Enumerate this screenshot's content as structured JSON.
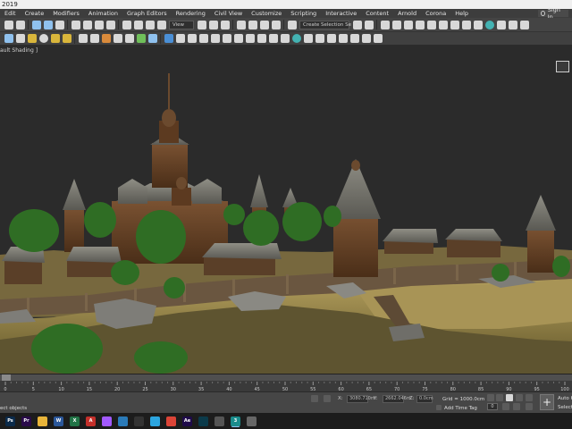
{
  "window": {
    "title": "2019"
  },
  "menu": {
    "items": [
      "Edit",
      "Create",
      "Modifiers",
      "Animation",
      "Graph Editors",
      "Rendering",
      "Civil View",
      "Customize",
      "Scripting",
      "Interactive",
      "Content",
      "Arnold",
      "Corona",
      "Help"
    ],
    "signin": "Sign In"
  },
  "toolbar": {
    "view_dropdown": "View",
    "selection_set_dropdown": "Create Selection Se"
  },
  "viewport": {
    "label": "ault Shading ]"
  },
  "timeline": {
    "ticks": [
      "0",
      "5",
      "10",
      "15",
      "20",
      "25",
      "30",
      "35",
      "40",
      "45",
      "50",
      "55",
      "60",
      "65",
      "70",
      "75",
      "80",
      "85",
      "90",
      "95",
      "100"
    ]
  },
  "status": {
    "message": "ect objects",
    "x_label": "X:",
    "x_value": "3080.710m",
    "y_label": "Y:",
    "y_value": "2662.046m",
    "z_label": "Z:",
    "z_value": "0.0cm",
    "grid": "Grid = 1000.0cm",
    "add_time_tag": "Add Time Tag",
    "frame": "0",
    "auto_key": "Auto Ke",
    "selected": "Selecte"
  },
  "taskbar": {
    "apps": [
      {
        "name": "ps",
        "label": "Ps",
        "color": "#0b2a4a"
      },
      {
        "name": "pr",
        "label": "Pr",
        "color": "#2a0b4a"
      },
      {
        "name": "folder",
        "label": "",
        "color": "#e8b43a"
      },
      {
        "name": "word",
        "label": "W",
        "color": "#2b579a"
      },
      {
        "name": "excel",
        "label": "X",
        "color": "#217346"
      },
      {
        "name": "acrobat",
        "label": "A",
        "color": "#c4302b"
      },
      {
        "name": "figma",
        "label": "",
        "color": "#a259ff"
      },
      {
        "name": "capture",
        "label": "",
        "color": "#2a7ab8"
      },
      {
        "name": "video",
        "label": "",
        "color": "#333333"
      },
      {
        "name": "telegram",
        "label": "",
        "color": "#2ca5e0"
      },
      {
        "name": "chrome",
        "label": "",
        "color": "#db4437"
      },
      {
        "name": "ae",
        "label": "Ae",
        "color": "#1f0b4a"
      },
      {
        "name": "lr",
        "label": "",
        "color": "#0b3a4a"
      },
      {
        "name": "unity",
        "label": "",
        "color": "#555555"
      },
      {
        "name": "max",
        "label": "3",
        "color": "#1a8c8c"
      },
      {
        "name": "corona",
        "label": "",
        "color": "#666666"
      }
    ]
  }
}
